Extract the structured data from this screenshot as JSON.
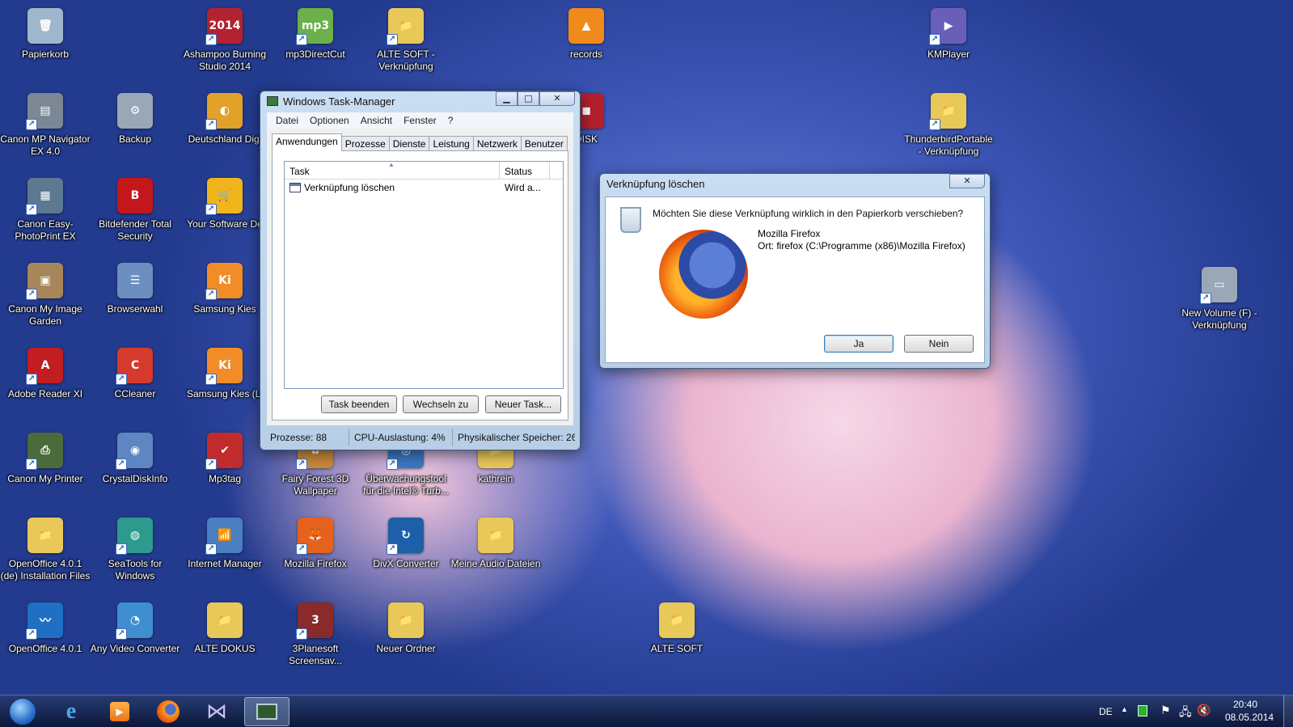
{
  "desktop": {
    "icons": [
      {
        "label": "Papierkorb",
        "glyph": "🗑",
        "color": "#9fb7cc",
        "shortcut": false
      },
      {
        "label": "Ashampoo Burning Studio 2014",
        "glyph": "2014",
        "color": "#b32230",
        "shortcut": true
      },
      {
        "label": "mp3DirectCut",
        "glyph": "mp3",
        "color": "#6bb04a",
        "shortcut": true
      },
      {
        "label": "ALTE SOFT - Verknüpfung",
        "glyph": "📁",
        "color": "#e9c85a",
        "shortcut": true
      },
      {
        "label": "records",
        "glyph": "▲",
        "color": "#f08a1c",
        "shortcut": false
      },
      {
        "label": "KMPlayer",
        "glyph": "▶",
        "color": "#6a5fb8",
        "shortcut": true
      },
      {
        "label": "Canon MP Navigator EX 4.0",
        "glyph": "▤",
        "color": "#7c8796",
        "shortcut": true
      },
      {
        "label": "Backup",
        "glyph": "⚙",
        "color": "#9aa7b6",
        "shortcut": false
      },
      {
        "label": "Deutschland Digi",
        "glyph": "◐",
        "color": "#e2a22a",
        "shortcut": true
      },
      {
        "label": "DISK",
        "glyph": "◼",
        "color": "#b3202d",
        "shortcut": false
      },
      {
        "label": "ThunderbirdPortable - Verknüpfung",
        "glyph": "📁",
        "color": "#e9c85a",
        "shortcut": true
      },
      {
        "label": "Canon Easy-PhotoPrint EX",
        "glyph": "▦",
        "color": "#5d7891",
        "shortcut": true
      },
      {
        "label": "Bitdefender Total Security",
        "glyph": "B",
        "color": "#c4171c",
        "shortcut": false
      },
      {
        "label": "Your Software De",
        "glyph": "🛒",
        "color": "#f0b41c",
        "shortcut": true
      },
      {
        "label": "New Volume (F) - Verknüpfung",
        "glyph": "▭",
        "color": "#9aa7b6",
        "shortcut": true
      },
      {
        "label": "Canon My Image Garden",
        "glyph": "▣",
        "color": "#a7865a",
        "shortcut": true
      },
      {
        "label": "Browserwahl",
        "glyph": "☰",
        "color": "#6c8fbf",
        "shortcut": false
      },
      {
        "label": "Samsung Kies",
        "glyph": "Ki",
        "color": "#f28c28",
        "shortcut": true
      },
      {
        "label": "Adobe Reader XI",
        "glyph": "A",
        "color": "#c21d20",
        "shortcut": true
      },
      {
        "label": "CCleaner",
        "glyph": "C",
        "color": "#d63a2c",
        "shortcut": true
      },
      {
        "label": "Samsung Kies (Li",
        "glyph": "Ki",
        "color": "#f28c28",
        "shortcut": true
      },
      {
        "label": "Canon My Printer",
        "glyph": "⎙",
        "color": "#4b6b3a",
        "shortcut": true
      },
      {
        "label": "CrystalDiskInfo",
        "glyph": "◉",
        "color": "#5e86c2",
        "shortcut": true
      },
      {
        "label": "Mp3tag",
        "glyph": "✔",
        "color": "#c22b2b",
        "shortcut": true
      },
      {
        "label": "Fairy Forest 3D Wallpaper",
        "glyph": "✿",
        "color": "#c88a3a",
        "shortcut": true
      },
      {
        "label": "Überwachungstool für die Intel® Turb...",
        "glyph": "◎",
        "color": "#3a78c4",
        "shortcut": true
      },
      {
        "label": "kathrein",
        "glyph": "📁",
        "color": "#e9c85a",
        "shortcut": false
      },
      {
        "label": "OpenOffice 4.0.1 (de) Installation Files",
        "glyph": "📁",
        "color": "#e9c85a",
        "shortcut": false
      },
      {
        "label": "SeaTools for Windows",
        "glyph": "◍",
        "color": "#2c9a8c",
        "shortcut": true
      },
      {
        "label": "Internet Manager",
        "glyph": "📶",
        "color": "#4a7fc2",
        "shortcut": true
      },
      {
        "label": "Mozilla Firefox",
        "glyph": "🦊",
        "color": "#e4621d",
        "shortcut": true
      },
      {
        "label": "DivX Converter",
        "glyph": "↻",
        "color": "#1d5fa8",
        "shortcut": true
      },
      {
        "label": "Meine Audio Dateien",
        "glyph": "📁",
        "color": "#e9c85a",
        "shortcut": false
      },
      {
        "label": "OpenOffice 4.0.1",
        "glyph": "〰",
        "color": "#1f6fc4",
        "shortcut": true
      },
      {
        "label": "Any Video Converter",
        "glyph": "◔",
        "color": "#3f8ed0",
        "shortcut": true
      },
      {
        "label": "ALTE DOKUS",
        "glyph": "📁",
        "color": "#e9c85a",
        "shortcut": false
      },
      {
        "label": "3Planesoft Screensav...",
        "glyph": "3",
        "color": "#8b2a2a",
        "shortcut": true
      },
      {
        "label": "Neuer Ordner",
        "glyph": "📁",
        "color": "#e9c85a",
        "shortcut": false
      },
      {
        "label": "ALTE SOFT",
        "glyph": "📁",
        "color": "#e9c85a",
        "shortcut": false
      }
    ]
  },
  "task_manager": {
    "title": "Windows Task-Manager",
    "menu": [
      "Datei",
      "Optionen",
      "Ansicht",
      "Fenster",
      "?"
    ],
    "tabs": [
      "Anwendungen",
      "Prozesse",
      "Dienste",
      "Leistung",
      "Netzwerk",
      "Benutzer"
    ],
    "active_tab": "Anwendungen",
    "columns": [
      "Task",
      "Status"
    ],
    "rows": [
      {
        "task": "Verknüpfung löschen",
        "status": "Wird a..."
      }
    ],
    "buttons": {
      "end": "Task beenden",
      "switch": "Wechseln zu",
      "new": "Neuer Task..."
    },
    "status": {
      "processes": "Prozesse: 88",
      "cpu": "CPU-Auslastung: 4%",
      "memory": "Physikalischer Speicher: 26"
    }
  },
  "dialog": {
    "title": "Verknüpfung löschen",
    "question": "Möchten Sie diese Verknüpfung wirklich in den Papierkorb verschieben?",
    "item_name": "Mozilla Firefox",
    "item_location": "Ort: firefox (C:\\Programme (x86)\\Mozilla Firefox)",
    "yes": "Ja",
    "no": "Nein"
  },
  "taskbar": {
    "language": "DE",
    "time": "20:40",
    "date": "08.05.2014",
    "pinned": [
      "start-orb",
      "internet-explorer",
      "media-player",
      "firefox",
      "kmplayer",
      "task-manager"
    ]
  },
  "colors": {
    "accent": "#3c5c86",
    "desktop_blue": "#2a3f9a",
    "pink": "#eab4cf"
  }
}
